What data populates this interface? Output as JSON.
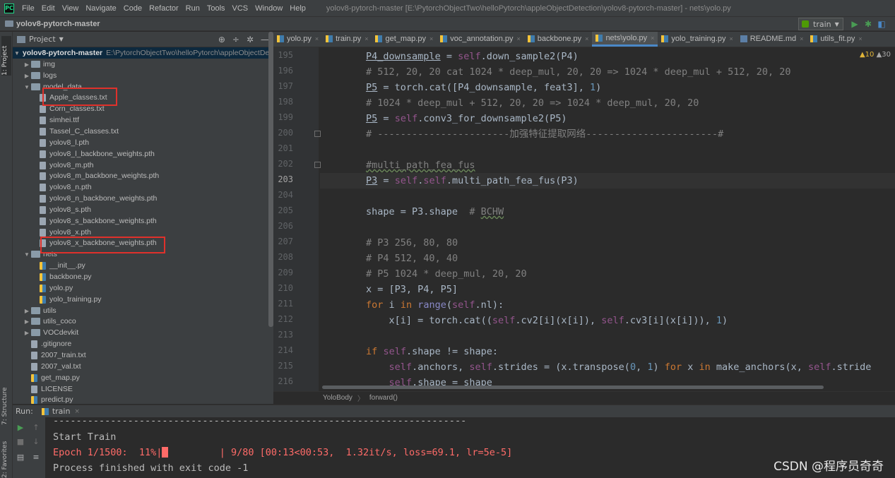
{
  "menu": {
    "items": [
      "File",
      "Edit",
      "View",
      "Navigate",
      "Code",
      "Refactor",
      "Run",
      "Tools",
      "VCS",
      "Window",
      "Help"
    ],
    "window_title": "yolov8-pytorch-master [E:\\PytorchObjectTwo\\helloPytorch\\appleObjectDetection\\yolov8-pytorch-master] - nets\\yolo.py"
  },
  "navbar": {
    "project_name": "yolov8-pytorch-master",
    "run_config": "train"
  },
  "left_strip": {
    "project_tab": "1: Project",
    "structure_tab": "7: Structure",
    "favorites_tab": "2: Favorites"
  },
  "project_panel": {
    "title": "Project",
    "root_name": "yolov8-pytorch-master",
    "root_path": "E:\\PytorchObjectTwo\\helloPytorch\\appleObjectDetection\\yolov8-pytorch-master",
    "tree": [
      {
        "name": "img",
        "kind": "folder",
        "depth": 1,
        "expanded": false
      },
      {
        "name": "logs",
        "kind": "folder",
        "depth": 1,
        "expanded": false
      },
      {
        "name": "model_data",
        "kind": "folder",
        "depth": 1,
        "expanded": true
      },
      {
        "name": "Apple_classes.txt",
        "kind": "txt",
        "depth": 2
      },
      {
        "name": "Corn_classes.txt",
        "kind": "txt",
        "depth": 2
      },
      {
        "name": "simhei.ttf",
        "kind": "txt",
        "depth": 2
      },
      {
        "name": "Tassel_C_classes.txt",
        "kind": "txt",
        "depth": 2
      },
      {
        "name": "yolov8_l.pth",
        "kind": "file",
        "depth": 2
      },
      {
        "name": "yolov8_l_backbone_weights.pth",
        "kind": "file",
        "depth": 2
      },
      {
        "name": "yolov8_m.pth",
        "kind": "file",
        "depth": 2
      },
      {
        "name": "yolov8_m_backbone_weights.pth",
        "kind": "file",
        "depth": 2
      },
      {
        "name": "yolov8_n.pth",
        "kind": "file",
        "depth": 2
      },
      {
        "name": "yolov8_n_backbone_weights.pth",
        "kind": "file",
        "depth": 2
      },
      {
        "name": "yolov8_s.pth",
        "kind": "file",
        "depth": 2
      },
      {
        "name": "yolov8_s_backbone_weights.pth",
        "kind": "file",
        "depth": 2
      },
      {
        "name": "yolov8_x.pth",
        "kind": "file",
        "depth": 2
      },
      {
        "name": "yolov8_x_backbone_weights.pth",
        "kind": "file",
        "depth": 2
      },
      {
        "name": "nets",
        "kind": "folder",
        "depth": 1,
        "expanded": true
      },
      {
        "name": "__init__.py",
        "kind": "py",
        "depth": 2
      },
      {
        "name": "backbone.py",
        "kind": "py",
        "depth": 2
      },
      {
        "name": "yolo.py",
        "kind": "py",
        "depth": 2
      },
      {
        "name": "yolo_training.py",
        "kind": "py",
        "depth": 2
      },
      {
        "name": "utils",
        "kind": "folder",
        "depth": 1,
        "expanded": false
      },
      {
        "name": "utils_coco",
        "kind": "folder",
        "depth": 1,
        "expanded": false
      },
      {
        "name": "VOCdevkit",
        "kind": "folder",
        "depth": 1,
        "expanded": false
      },
      {
        "name": ".gitignore",
        "kind": "txt",
        "depth": 1
      },
      {
        "name": "2007_train.txt",
        "kind": "txt",
        "depth": 1
      },
      {
        "name": "2007_val.txt",
        "kind": "txt",
        "depth": 1
      },
      {
        "name": "get_map.py",
        "kind": "py",
        "depth": 1
      },
      {
        "name": "LICENSE",
        "kind": "txt",
        "depth": 1
      },
      {
        "name": "predict.py",
        "kind": "py",
        "depth": 1
      }
    ]
  },
  "tabs": [
    {
      "label": "yolo.py",
      "active": false
    },
    {
      "label": "train.py",
      "active": false
    },
    {
      "label": "get_map.py",
      "active": false
    },
    {
      "label": "voc_annotation.py",
      "active": false
    },
    {
      "label": "backbone.py",
      "active": false
    },
    {
      "label": "nets\\yolo.py",
      "active": true
    },
    {
      "label": "yolo_training.py",
      "active": false
    },
    {
      "label": "README.md",
      "active": false
    },
    {
      "label": "utils_fit.py",
      "active": false
    }
  ],
  "editor": {
    "warnings": "▲10",
    "weak_warnings": "▲30",
    "current_line": "203",
    "line_numbers": [
      "195",
      "196",
      "197",
      "198",
      "199",
      "200",
      "201",
      "202",
      "203",
      "204",
      "205",
      "206",
      "207",
      "208",
      "209",
      "210",
      "211",
      "212",
      "213",
      "214",
      "215",
      "216"
    ]
  },
  "breadcrumbs": [
    "YoloBody",
    "forward()"
  ],
  "run_panel": {
    "label": "Run:",
    "tab": "train",
    "console": [
      "------------------------------------------------------------------------",
      "Start Train",
      "Epoch 1/1500:  11%|",
      "| 9/80 [00:13<00:53,  1.32it/s, loss=69.1, lr=5e-5]",
      "Process finished with exit code -1"
    ],
    "progress": 0.11
  },
  "watermark": "CSDN @程序员奇奇",
  "colors": {
    "accent": "#4a88c7",
    "highlight_box": "#e0312b",
    "error_text": "#ff6b68",
    "keyword": "#cc7832",
    "self": "#94558d",
    "comment": "#808080",
    "number": "#6897bb"
  }
}
